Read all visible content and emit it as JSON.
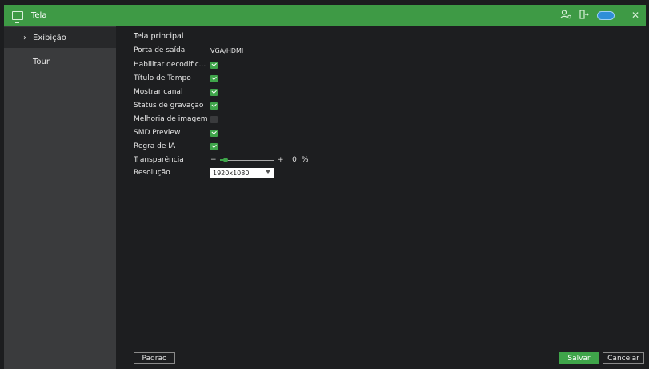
{
  "window": {
    "title": "Tela",
    "icons": [
      "monitor-icon",
      "user-settings-icon",
      "logout-icon",
      "cloud-icon",
      "close-icon"
    ]
  },
  "sidebar": {
    "items": [
      {
        "label": "Exibição",
        "active": true
      },
      {
        "label": "Tour",
        "active": false
      }
    ]
  },
  "main": {
    "section_title": "Tela principal",
    "output_port": {
      "label": "Porta de saída",
      "value": "VGA/HDMI"
    },
    "checkboxes": [
      {
        "label": "Habilitar decodific...",
        "checked": true
      },
      {
        "label": "Título de Tempo",
        "checked": true
      },
      {
        "label": "Mostrar canal",
        "checked": true
      },
      {
        "label": "Status de gravação",
        "checked": true
      },
      {
        "label": "Melhoria de imagem",
        "checked": false
      },
      {
        "label": "SMD Preview",
        "checked": true
      },
      {
        "label": "Regra de IA",
        "checked": true
      }
    ],
    "transparency": {
      "label": "Transparência",
      "minus": "−",
      "plus": "+",
      "value": "0",
      "unit": "%",
      "fraction": 0.1
    },
    "resolution": {
      "label": "Resolução",
      "value": "1920x1080"
    }
  },
  "buttons": {
    "default": "Padrão",
    "save": "Salvar",
    "cancel": "Cancelar"
  },
  "colors": {
    "accent": "#3e9a45",
    "background": "#1d1e20",
    "sidebar": "#3a3b3d"
  }
}
